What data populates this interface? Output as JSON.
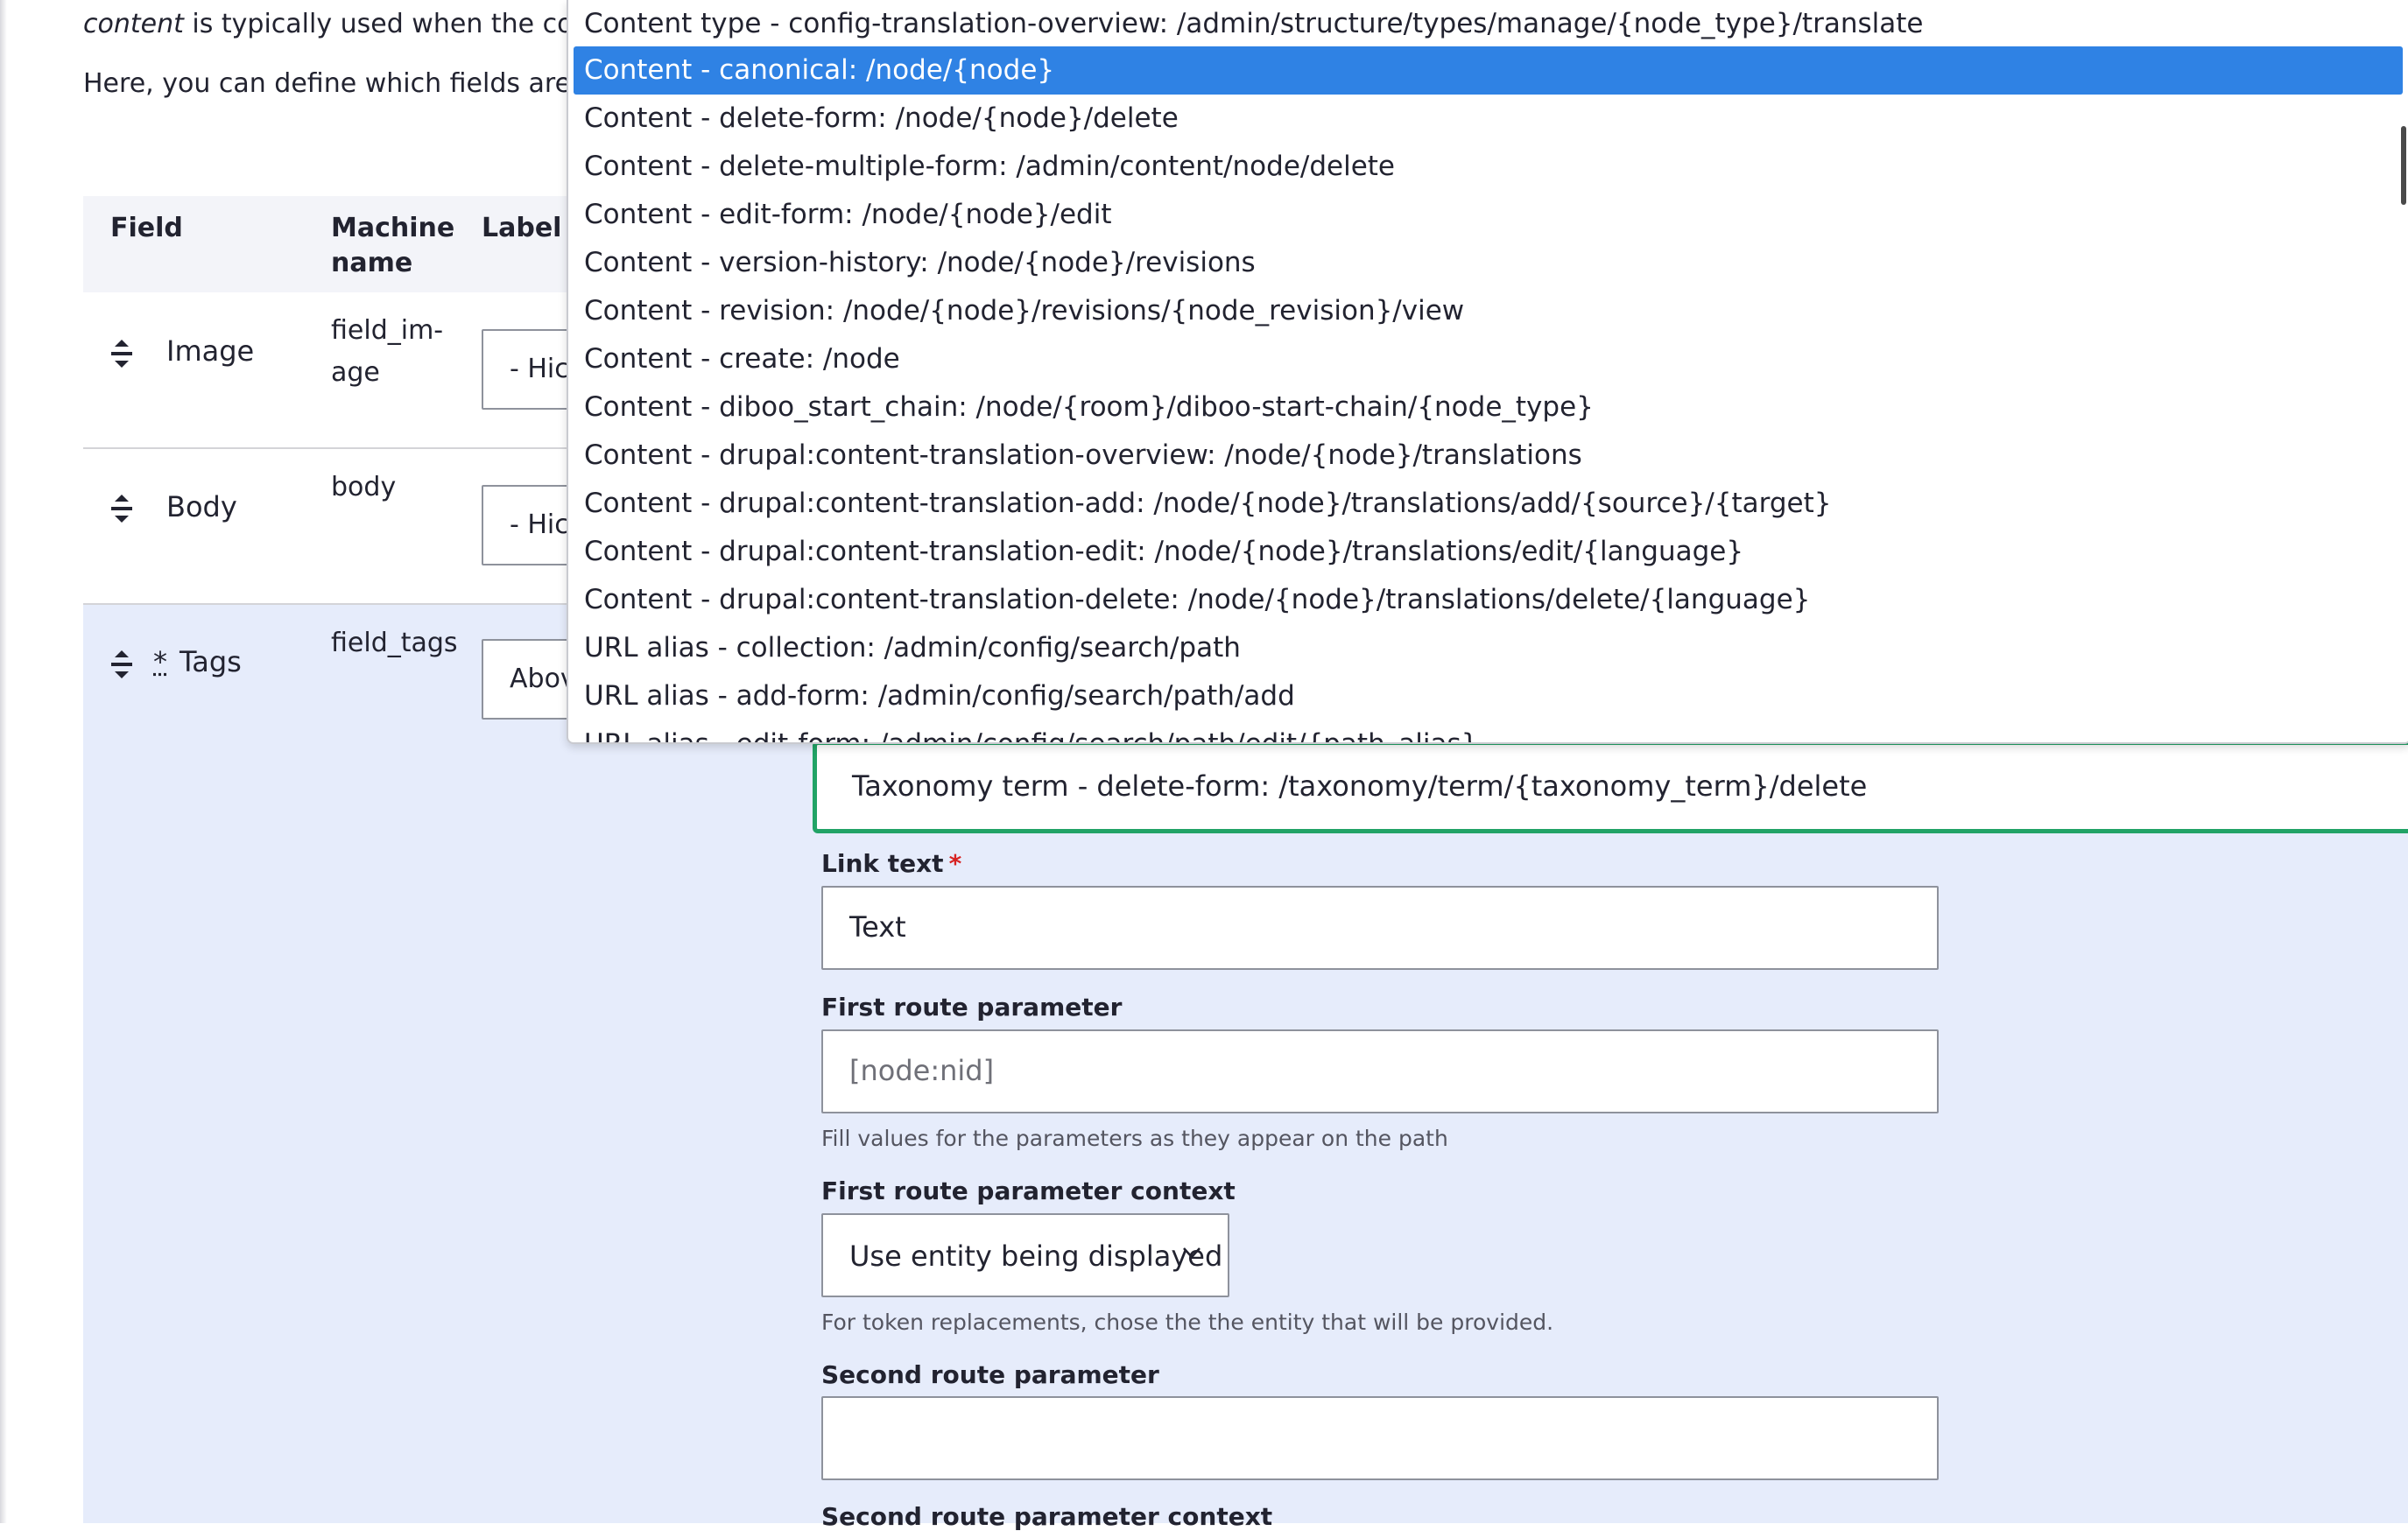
{
  "intro": {
    "line1_em": "content",
    "line1_rest": " is typically used when the conte",
    "line2": "Here, you can define which fields are sh"
  },
  "table": {
    "headers": {
      "field": "Field",
      "machine_line1": "Machine",
      "machine_line2": "name",
      "label": "Label"
    },
    "rows": [
      {
        "field": "Image",
        "machine_line1": "field_im-",
        "machine_line2": "age",
        "label_value": "- Hic"
      },
      {
        "field": "Body",
        "machine_line1": "body",
        "machine_line2": "",
        "label_value": "- Hic"
      },
      {
        "field": "Tags",
        "required_mark": "*",
        "machine_line1": "field_tags",
        "machine_line2": "",
        "label_value": "Abov"
      }
    ]
  },
  "dropdown": {
    "selected_index": 1,
    "options": [
      "Content type - config-translation-overview: /admin/structure/types/manage/{node_type}/translate",
      "Content - canonical: /node/{node}",
      "Content - delete-form: /node/{node}/delete",
      "Content - delete-multiple-form: /admin/content/node/delete",
      "Content - edit-form: /node/{node}/edit",
      "Content - version-history: /node/{node}/revisions",
      "Content - revision: /node/{node}/revisions/{node_revision}/view",
      "Content - create: /node",
      "Content - diboo_start_chain: /node/{room}/diboo-start-chain/{node_type}",
      "Content - drupal:content-translation-overview: /node/{node}/translations",
      "Content - drupal:content-translation-add: /node/{node}/translations/add/{source}/{target}",
      "Content - drupal:content-translation-edit: /node/{node}/translations/edit/{language}",
      "Content - drupal:content-translation-delete: /node/{node}/translations/delete/{language}",
      "URL alias - collection: /admin/config/search/path",
      "URL alias - add-form: /admin/config/search/path/add",
      "URL alias - edit-form: /admin/config/search/path/edit/{path_alias}"
    ]
  },
  "form": {
    "route_value": "Taxonomy term - delete-form: /taxonomy/term/{taxonomy_term}/delete",
    "link_text_label": "Link text",
    "link_text_required": "*",
    "link_text_value": "Text",
    "first_param_label": "First route parameter",
    "first_param_placeholder": "[node:nid]",
    "first_param_help": "Fill values for the parameters as they appear on the path",
    "first_context_label": "First route parameter context",
    "first_context_value": "Use entity being displayed",
    "first_context_help": "For token replacements, chose the the entity that will be provided.",
    "second_param_label": "Second route parameter",
    "second_param_value": "",
    "second_context_label": "Second route parameter context"
  },
  "colors": {
    "selected_option": "#2f82e4",
    "active_row_bg": "#e6ecfb",
    "focus_border": "#21a366",
    "required": "#d72222"
  }
}
